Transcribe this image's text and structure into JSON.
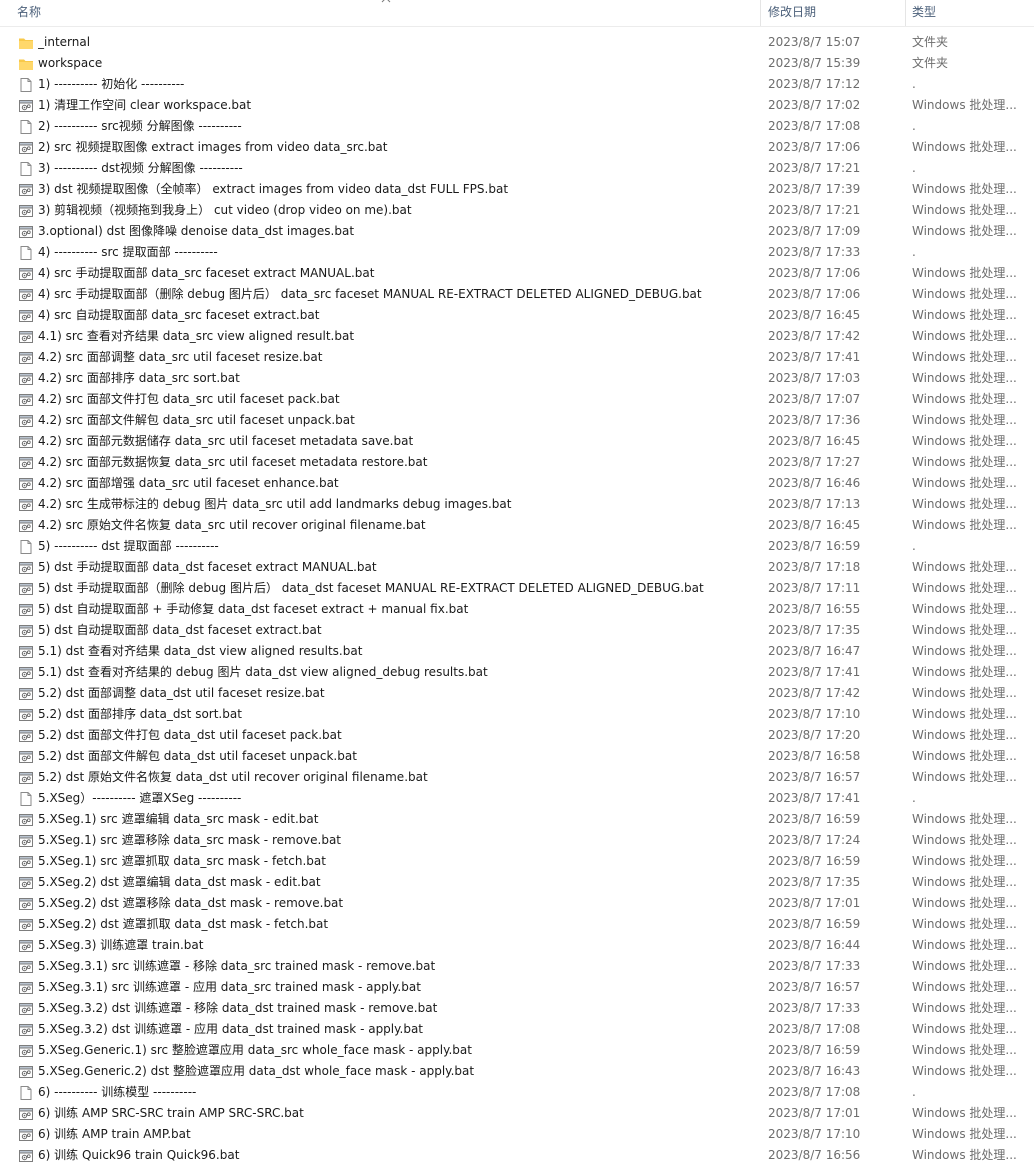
{
  "header": {
    "name_label": "名称",
    "date_label": "修改日期",
    "type_label": "类型"
  },
  "icons": {
    "folder": "folder-icon",
    "file": "file-icon",
    "batch": "batch-file-icon"
  },
  "colors": {
    "folder": "#ffd86b",
    "header_text": "#4c607a",
    "meta_text": "#6d6d6d"
  },
  "files": [
    {
      "name": "_internal",
      "date": "2023/8/7 15:07",
      "type": "文件夹",
      "icon": "folder"
    },
    {
      "name": "workspace",
      "date": "2023/8/7 15:39",
      "type": "文件夹",
      "icon": "folder"
    },
    {
      "name": "1)  ---------- 初始化 ----------",
      "date": "2023/8/7 17:12",
      "type": ".",
      "icon": "file"
    },
    {
      "name": "1) 清理工作空间 clear workspace.bat",
      "date": "2023/8/7 17:02",
      "type": "Windows 批处理...",
      "icon": "batch"
    },
    {
      "name": "2)  ---------- src视频 分解图像 ----------",
      "date": "2023/8/7 17:08",
      "type": ".",
      "icon": "file"
    },
    {
      "name": "2) src 视频提取图像 extract images from video data_src.bat",
      "date": "2023/8/7 17:06",
      "type": "Windows 批处理...",
      "icon": "batch"
    },
    {
      "name": "3)  ---------- dst视频 分解图像 ----------",
      "date": "2023/8/7 17:21",
      "type": ".",
      "icon": "file"
    },
    {
      "name": "3) dst 视频提取图像（全帧率） extract images from video data_dst FULL FPS.bat",
      "date": "2023/8/7 17:39",
      "type": "Windows 批处理...",
      "icon": "batch"
    },
    {
      "name": "3) 剪辑视频（视频拖到我身上） cut video (drop video on me).bat",
      "date": "2023/8/7 17:21",
      "type": "Windows 批处理...",
      "icon": "batch"
    },
    {
      "name": "3.optional) dst 图像降噪 denoise data_dst images.bat",
      "date": "2023/8/7 17:09",
      "type": "Windows 批处理...",
      "icon": "batch"
    },
    {
      "name": "4)  ---------- src 提取面部 ----------",
      "date": "2023/8/7 17:33",
      "type": ".",
      "icon": "file"
    },
    {
      "name": "4) src 手动提取面部 data_src faceset extract MANUAL.bat",
      "date": "2023/8/7 17:06",
      "type": "Windows 批处理...",
      "icon": "batch"
    },
    {
      "name": "4) src 手动提取面部（删除 debug 图片后） data_src faceset MANUAL RE-EXTRACT DELETED ALIGNED_DEBUG.bat",
      "date": "2023/8/7 17:06",
      "type": "Windows 批处理...",
      "icon": "batch"
    },
    {
      "name": "4) src 自动提取面部 data_src faceset extract.bat",
      "date": "2023/8/7 16:45",
      "type": "Windows 批处理...",
      "icon": "batch"
    },
    {
      "name": "4.1) src 查看对齐结果 data_src view aligned result.bat",
      "date": "2023/8/7 17:42",
      "type": "Windows 批处理...",
      "icon": "batch"
    },
    {
      "name": "4.2) src 面部调整 data_src util faceset resize.bat",
      "date": "2023/8/7 17:41",
      "type": "Windows 批处理...",
      "icon": "batch"
    },
    {
      "name": "4.2) src 面部排序 data_src sort.bat",
      "date": "2023/8/7 17:03",
      "type": "Windows 批处理...",
      "icon": "batch"
    },
    {
      "name": "4.2) src 面部文件打包 data_src util faceset pack.bat",
      "date": "2023/8/7 17:07",
      "type": "Windows 批处理...",
      "icon": "batch"
    },
    {
      "name": "4.2) src 面部文件解包 data_src util faceset unpack.bat",
      "date": "2023/8/7 17:36",
      "type": "Windows 批处理...",
      "icon": "batch"
    },
    {
      "name": "4.2) src 面部元数据储存 data_src util faceset metadata save.bat",
      "date": "2023/8/7 16:45",
      "type": "Windows 批处理...",
      "icon": "batch"
    },
    {
      "name": "4.2) src 面部元数据恢复 data_src util faceset metadata restore.bat",
      "date": "2023/8/7 17:27",
      "type": "Windows 批处理...",
      "icon": "batch"
    },
    {
      "name": "4.2) src 面部增强 data_src util faceset enhance.bat",
      "date": "2023/8/7 16:46",
      "type": "Windows 批处理...",
      "icon": "batch"
    },
    {
      "name": "4.2) src 生成带标注的 debug 图片 data_src util add landmarks debug images.bat",
      "date": "2023/8/7 17:13",
      "type": "Windows 批处理...",
      "icon": "batch"
    },
    {
      "name": "4.2) src 原始文件名恢复 data_src util recover original filename.bat",
      "date": "2023/8/7 16:45",
      "type": "Windows 批处理...",
      "icon": "batch"
    },
    {
      "name": "5)  ---------- dst 提取面部 ----------",
      "date": "2023/8/7 16:59",
      "type": ".",
      "icon": "file"
    },
    {
      "name": "5) dst 手动提取面部 data_dst faceset extract MANUAL.bat",
      "date": "2023/8/7 17:18",
      "type": "Windows 批处理...",
      "icon": "batch"
    },
    {
      "name": "5) dst 手动提取面部（删除 debug 图片后） data_dst faceset MANUAL RE-EXTRACT DELETED ALIGNED_DEBUG.bat",
      "date": "2023/8/7 17:11",
      "type": "Windows 批处理...",
      "icon": "batch"
    },
    {
      "name": "5) dst 自动提取面部 + 手动修复 data_dst faceset extract + manual fix.bat",
      "date": "2023/8/7 16:55",
      "type": "Windows 批处理...",
      "icon": "batch"
    },
    {
      "name": "5) dst 自动提取面部 data_dst faceset extract.bat",
      "date": "2023/8/7 17:35",
      "type": "Windows 批处理...",
      "icon": "batch"
    },
    {
      "name": "5.1) dst 查看对齐结果 data_dst view aligned results.bat",
      "date": "2023/8/7 16:47",
      "type": "Windows 批处理...",
      "icon": "batch"
    },
    {
      "name": "5.1) dst 查看对齐结果的 debug 图片 data_dst view aligned_debug results.bat",
      "date": "2023/8/7 17:41",
      "type": "Windows 批处理...",
      "icon": "batch"
    },
    {
      "name": "5.2) dst 面部调整 data_dst util faceset resize.bat",
      "date": "2023/8/7 17:42",
      "type": "Windows 批处理...",
      "icon": "batch"
    },
    {
      "name": "5.2) dst 面部排序 data_dst sort.bat",
      "date": "2023/8/7 17:10",
      "type": "Windows 批处理...",
      "icon": "batch"
    },
    {
      "name": "5.2) dst 面部文件打包 data_dst util faceset pack.bat",
      "date": "2023/8/7 17:20",
      "type": "Windows 批处理...",
      "icon": "batch"
    },
    {
      "name": "5.2) dst 面部文件解包 data_dst util faceset unpack.bat",
      "date": "2023/8/7 16:58",
      "type": "Windows 批处理...",
      "icon": "batch"
    },
    {
      "name": "5.2) dst 原始文件名恢复 data_dst util recover original filename.bat",
      "date": "2023/8/7 16:57",
      "type": "Windows 批处理...",
      "icon": "batch"
    },
    {
      "name": "5.XSeg）---------- 遮罩XSeg ----------",
      "date": "2023/8/7 17:41",
      "type": ".",
      "icon": "file"
    },
    {
      "name": "5.XSeg.1) src 遮罩编辑 data_src mask - edit.bat",
      "date": "2023/8/7 16:59",
      "type": "Windows 批处理...",
      "icon": "batch"
    },
    {
      "name": "5.XSeg.1) src 遮罩移除 data_src mask - remove.bat",
      "date": "2023/8/7 17:24",
      "type": "Windows 批处理...",
      "icon": "batch"
    },
    {
      "name": "5.XSeg.1) src 遮罩抓取 data_src mask - fetch.bat",
      "date": "2023/8/7 16:59",
      "type": "Windows 批处理...",
      "icon": "batch"
    },
    {
      "name": "5.XSeg.2) dst 遮罩编辑 data_dst mask - edit.bat",
      "date": "2023/8/7 17:35",
      "type": "Windows 批处理...",
      "icon": "batch"
    },
    {
      "name": "5.XSeg.2) dst 遮罩移除 data_dst mask - remove.bat",
      "date": "2023/8/7 17:01",
      "type": "Windows 批处理...",
      "icon": "batch"
    },
    {
      "name": "5.XSeg.2) dst 遮罩抓取 data_dst mask - fetch.bat",
      "date": "2023/8/7 16:59",
      "type": "Windows 批处理...",
      "icon": "batch"
    },
    {
      "name": "5.XSeg.3) 训练遮罩 train.bat",
      "date": "2023/8/7 16:44",
      "type": "Windows 批处理...",
      "icon": "batch"
    },
    {
      "name": "5.XSeg.3.1) src 训练遮罩 - 移除 data_src trained mask - remove.bat",
      "date": "2023/8/7 17:33",
      "type": "Windows 批处理...",
      "icon": "batch"
    },
    {
      "name": "5.XSeg.3.1) src 训练遮罩 - 应用 data_src trained mask - apply.bat",
      "date": "2023/8/7 16:57",
      "type": "Windows 批处理...",
      "icon": "batch"
    },
    {
      "name": "5.XSeg.3.2) dst 训练遮罩 - 移除 data_dst trained mask - remove.bat",
      "date": "2023/8/7 17:33",
      "type": "Windows 批处理...",
      "icon": "batch"
    },
    {
      "name": "5.XSeg.3.2) dst 训练遮罩 - 应用 data_dst trained mask - apply.bat",
      "date": "2023/8/7 17:08",
      "type": "Windows 批处理...",
      "icon": "batch"
    },
    {
      "name": "5.XSeg.Generic.1) src 整脸遮罩应用 data_src whole_face mask - apply.bat",
      "date": "2023/8/7 16:59",
      "type": "Windows 批处理...",
      "icon": "batch"
    },
    {
      "name": "5.XSeg.Generic.2) dst 整脸遮罩应用 data_dst whole_face mask - apply.bat",
      "date": "2023/8/7 16:43",
      "type": "Windows 批处理...",
      "icon": "batch"
    },
    {
      "name": "6)  ---------- 训练模型 ----------",
      "date": "2023/8/7 17:08",
      "type": ".",
      "icon": "file"
    },
    {
      "name": "6) 训练 AMP SRC-SRC train AMP SRC-SRC.bat",
      "date": "2023/8/7 17:01",
      "type": "Windows 批处理...",
      "icon": "batch"
    },
    {
      "name": "6) 训练 AMP train AMP.bat",
      "date": "2023/8/7 17:10",
      "type": "Windows 批处理...",
      "icon": "batch"
    },
    {
      "name": "6) 训练 Quick96 train Quick96.bat",
      "date": "2023/8/7 16:56",
      "type": "Windows 批处理...",
      "icon": "batch"
    }
  ]
}
